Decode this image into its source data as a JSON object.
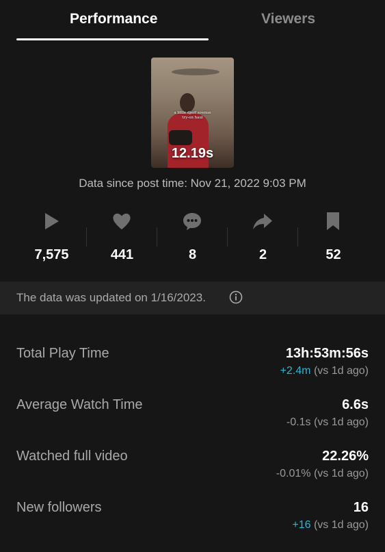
{
  "tabs": [
    {
      "label": "Performance",
      "active": true
    },
    {
      "label": "Viewers",
      "active": false
    }
  ],
  "video": {
    "duration": "12.19s",
    "overlay_line1": "a little djerf avenue",
    "overlay_line2": "try-on haul"
  },
  "data_since": "Data since post time: Nov 21, 2022 9:03 PM",
  "stats": [
    {
      "icon": "play-icon",
      "value": "7,575"
    },
    {
      "icon": "heart-icon",
      "value": "441"
    },
    {
      "icon": "comment-icon",
      "value": "8"
    },
    {
      "icon": "share-icon",
      "value": "2"
    },
    {
      "icon": "bookmark-icon",
      "value": "52"
    }
  ],
  "banner": {
    "text": "The data was updated on 1/16/2023.",
    "icon": "info-icon"
  },
  "metrics": [
    {
      "label": "Total Play Time",
      "value": "13h:53m:56s",
      "delta": "+2.4m",
      "delta_suffix": "(vs 1d ago)",
      "delta_positive": true
    },
    {
      "label": "Average Watch Time",
      "value": "6.6s",
      "delta": "-0.1s",
      "delta_suffix": "(vs 1d ago)",
      "delta_positive": false
    },
    {
      "label": "Watched full video",
      "value": "22.26%",
      "delta": "-0.01%",
      "delta_suffix": "(vs 1d ago)",
      "delta_positive": false
    },
    {
      "label": "New followers",
      "value": "16",
      "delta": "+16",
      "delta_suffix": "(vs 1d ago)",
      "delta_positive": true
    }
  ],
  "colors": {
    "background": "#161616",
    "banner_bg": "#232323",
    "positive_delta": "#2cb6d3",
    "muted_text": "#a9a9a9",
    "icon_gray": "#6f6f6f"
  }
}
